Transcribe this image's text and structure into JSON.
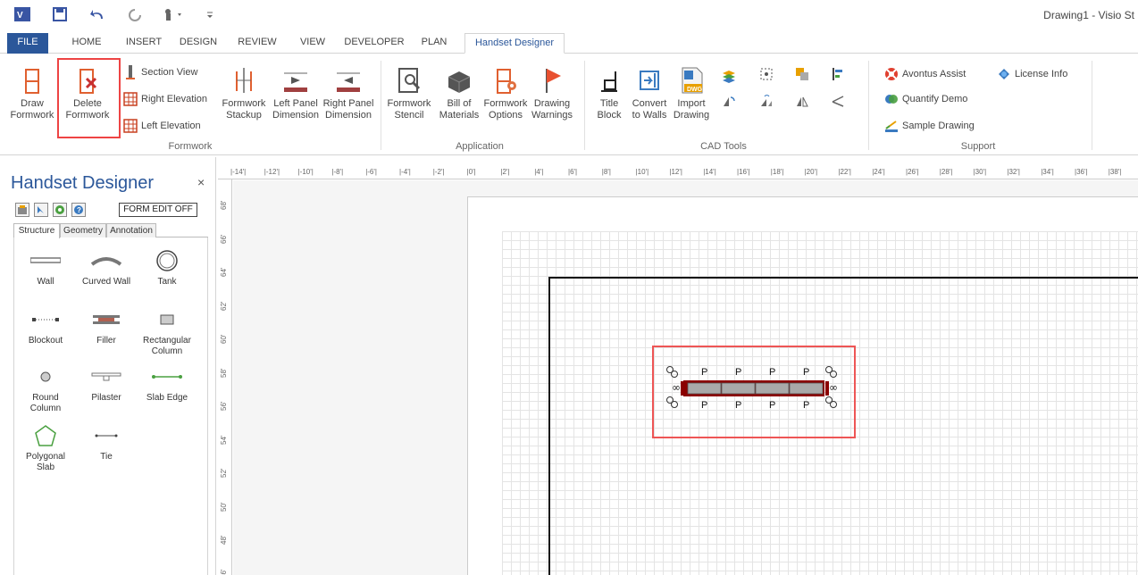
{
  "app_title": "Drawing1 - Visio St",
  "tabs": [
    "FILE",
    "HOME",
    "INSERT",
    "DESIGN",
    "REVIEW",
    "VIEW",
    "DEVELOPER",
    "PLAN",
    "Handset Designer"
  ],
  "ribbon": {
    "formwork": {
      "draw": [
        "Draw",
        "Formwork"
      ],
      "delete": [
        "Delete",
        "Formwork"
      ],
      "section_view": "Section View",
      "right_elevation": "Right Elevation",
      "left_elevation": "Left Elevation",
      "stackup": [
        "Formwork",
        "Stackup"
      ],
      "left_panel": [
        "Left Panel",
        "Dimension"
      ],
      "right_panel": [
        "Right Panel",
        "Dimension"
      ],
      "group": "Formwork"
    },
    "application": {
      "stencil": [
        "Formwork",
        "Stencil"
      ],
      "bom": [
        "Bill of",
        "Materials"
      ],
      "options": [
        "Formwork",
        "Options"
      ],
      "warnings": [
        "Drawing",
        "Warnings"
      ],
      "group": "Application"
    },
    "cad": {
      "title_block": [
        "Title",
        "Block"
      ],
      "convert": [
        "Convert",
        "to Walls"
      ],
      "import": [
        "Import",
        "Drawing"
      ],
      "dwg": "DWG",
      "group": "CAD Tools"
    },
    "support": {
      "avontus": "Avontus Assist",
      "license": "License Info",
      "quantify": "Quantify Demo",
      "sample": "Sample Drawing",
      "group": "Support"
    }
  },
  "panel": {
    "title": "Handset Designer",
    "close": "×",
    "form_edit": "FORM EDIT OFF",
    "tabs": [
      "Structure",
      "Geometry",
      "Annotation"
    ],
    "shapes": [
      {
        "label": "Wall"
      },
      {
        "label": "Curved Wall"
      },
      {
        "label": "Tank"
      },
      {
        "label": "Blockout"
      },
      {
        "label": "Filler"
      },
      {
        "label": "Rectangular Column"
      },
      {
        "label": "Round Column"
      },
      {
        "label": "Pilaster"
      },
      {
        "label": "Slab Edge"
      },
      {
        "label": "Polygonal Slab"
      },
      {
        "label": "Tie"
      }
    ]
  },
  "ruler": {
    "h": [
      "-14'",
      "-12'",
      "-10'",
      "-8'",
      "-6'",
      "-4'",
      "-2'",
      "0'",
      "2'",
      "4'",
      "6'",
      "8'",
      "10'",
      "12'",
      "14'",
      "16'",
      "18'",
      "20'",
      "22'",
      "24'",
      "26'",
      "28'",
      "30'",
      "32'",
      "34'",
      "36'",
      "38'"
    ],
    "v": [
      "68'",
      "66'",
      "64'",
      "62'",
      "60'",
      "58'",
      "56'",
      "54'",
      "52'",
      "50'",
      "48'",
      "46'"
    ]
  },
  "formwork": {
    "panel_label": "P",
    "corner_label": "∞"
  },
  "colors": {
    "file_tab": "#2b579a",
    "accent": "#2b579a",
    "highlight": "#e44",
    "formwork_edge": "#8b0000",
    "formwork_fill": "#a9a9a9"
  }
}
